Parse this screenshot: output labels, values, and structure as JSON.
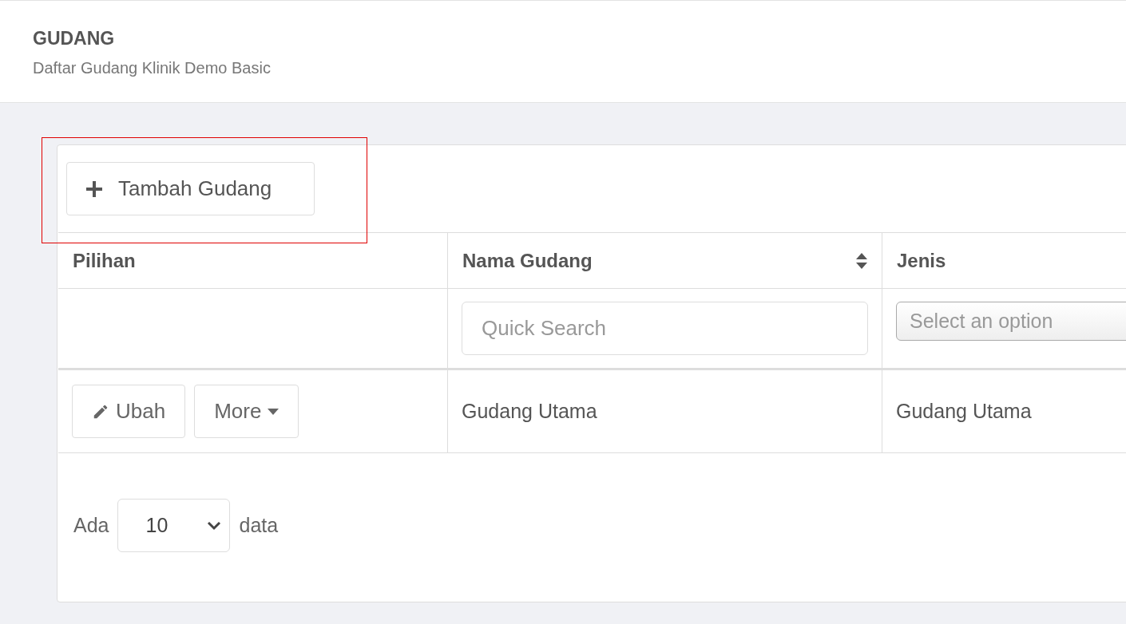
{
  "header": {
    "title": "GUDANG",
    "subtitle": "Daftar Gudang Klinik Demo Basic"
  },
  "add_button": {
    "label": "Tambah Gudang"
  },
  "table": {
    "columns": [
      {
        "label": "Pilihan",
        "sortable": false
      },
      {
        "label": "Nama Gudang",
        "sortable": true
      },
      {
        "label": "Jenis",
        "sortable": false
      }
    ],
    "filters": [
      {
        "kind": "none"
      },
      {
        "kind": "search",
        "placeholder": "Quick Search"
      },
      {
        "kind": "select",
        "placeholder": "Select an option"
      }
    ],
    "rows": [
      {
        "cells": [
          {
            "kind": "actions",
            "actions": [
              {
                "label": "Ubah",
                "kind": "edit"
              },
              {
                "label": "More",
                "kind": "dropdown"
              }
            ]
          },
          {
            "kind": "text",
            "text": "Gudang Utama"
          },
          {
            "kind": "text",
            "text": "Gudang Utama"
          }
        ]
      }
    ]
  },
  "pagination": {
    "prefix": "Ada",
    "page_size": "10",
    "suffix": "data"
  }
}
